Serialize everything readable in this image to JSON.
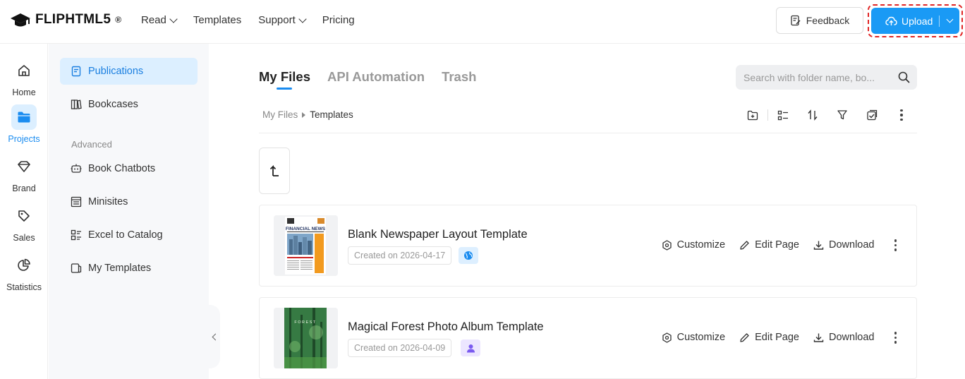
{
  "brand": {
    "name": "FLIPHTML5",
    "mark": "®"
  },
  "topnav": [
    {
      "label": "Read",
      "has_caret": true
    },
    {
      "label": "Templates",
      "has_caret": false
    },
    {
      "label": "Support",
      "has_caret": true
    },
    {
      "label": "Pricing",
      "has_caret": false
    }
  ],
  "header": {
    "feedback_label": "Feedback",
    "upload_label": "Upload"
  },
  "rail": {
    "home": "Home",
    "projects": "Projects",
    "brand": "Brand",
    "sales": "Sales",
    "statistics": "Statistics"
  },
  "sidebar": {
    "publications": "Publications",
    "bookcases": "Bookcases",
    "advanced_heading": "Advanced",
    "book_chatbots": "Book Chatbots",
    "minisites": "Minisites",
    "excel_to_catalog": "Excel to Catalog",
    "my_templates": "My Templates"
  },
  "tabs": {
    "my_files": "My Files",
    "api_automation": "API Automation",
    "trash": "Trash"
  },
  "search": {
    "placeholder": "Search with folder name, bo..."
  },
  "breadcrumb": {
    "root": "My Files",
    "current": "Templates"
  },
  "files": [
    {
      "title": "Blank Newspaper Layout Template",
      "date": "Created on 2026-04-17",
      "badge": "globe-icon",
      "thumb_text": "FINANCIAL NEWS"
    },
    {
      "title": "Magical Forest Photo Album Template",
      "date": "Created on 2026-04-09",
      "badge": "user-icon",
      "thumb_text": "FOREST"
    }
  ],
  "actions": {
    "customize": "Customize",
    "edit_page": "Edit Page",
    "download": "Download"
  },
  "colors": {
    "accent": "#1a9af5",
    "highlight_border": "#e02424",
    "active_bg": "#dcefff",
    "globe_badge": "#ddefff",
    "user_badge": "#ece6ff"
  }
}
